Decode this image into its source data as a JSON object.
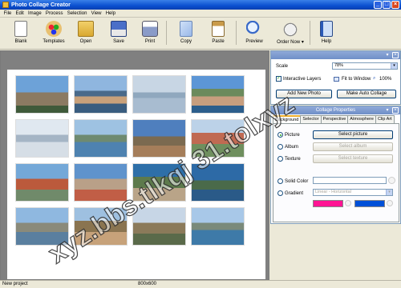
{
  "window": {
    "title": "Photo Collage Creator"
  },
  "menu": [
    "File",
    "Edit",
    "Image",
    "Process",
    "Selection",
    "View",
    "Help"
  ],
  "toolbar": {
    "blank": "Blank",
    "templates": "Templates",
    "open": "Open",
    "save": "Save",
    "print": "Print",
    "copy": "Copy",
    "paste": "Paste",
    "preview": "Preview",
    "order_now": "Order Now",
    "help": "Help"
  },
  "scale_panel": {
    "scale_label": "Scale",
    "scale_value": "78%",
    "interactive_layers": "Interactive Layers",
    "fit_to_window": "Fit to Window",
    "zoom_100": "100%",
    "add_new_photo": "Add New Photo",
    "make_auto_collage": "Make Auto Collage"
  },
  "collage_properties": {
    "title": "Collage Properties",
    "tabs": [
      "Background",
      "Selector",
      "Perspective",
      "Atmosphere",
      "Clip Art"
    ],
    "picture_label": "Picture",
    "select_picture": "Select picture",
    "album_label": "Album",
    "select_album": "Select album",
    "texture_label": "Texture",
    "select_texture": "Select texture",
    "solid_color_label": "Solid Color",
    "gradient_label": "Gradient",
    "gradient_value": "Linear - Horizontal",
    "gradient_color_1": "#ff1493",
    "gradient_color_2": "#0050d8"
  },
  "status": {
    "project": "New project",
    "size": "800x600"
  },
  "watermark": "xyz.bbs.tlkqj 31.tolxyz"
}
